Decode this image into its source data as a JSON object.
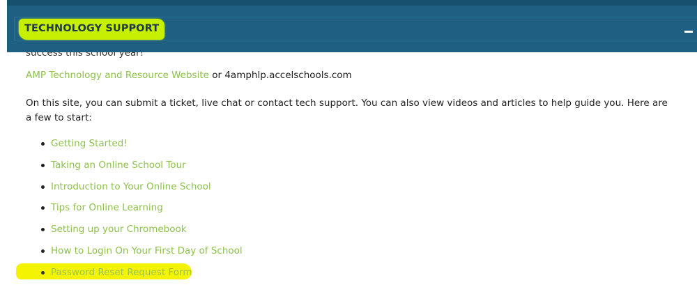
{
  "header": {
    "title": "TECHNOLOGY SUPPORT",
    "toggle_symbol": "−"
  },
  "content": {
    "cut_text": "success this school year!",
    "site_link": "AMP Technology and Resource Website",
    "site_connector": " or ",
    "site_url": "4amphlp.accelschools.com",
    "paragraph": "On this site, you can submit a ticket, live chat or contact tech support. You can also view videos and articles to help guide you. Here are a few to start:",
    "links": [
      {
        "label": "Getting Started!"
      },
      {
        "label": "Taking an Online School Tour"
      },
      {
        "label": "Introduction to Your Online School"
      },
      {
        "label": "Tips for Online Learning"
      },
      {
        "label": "Setting up your Chromebook"
      },
      {
        "label": "How to Login On Your First Day of School"
      },
      {
        "label": "Password Reset Request Form"
      }
    ]
  },
  "colors": {
    "header_bg": "#1f5f82",
    "highlight": "#f4f400",
    "link_green": "#8dc14b"
  }
}
